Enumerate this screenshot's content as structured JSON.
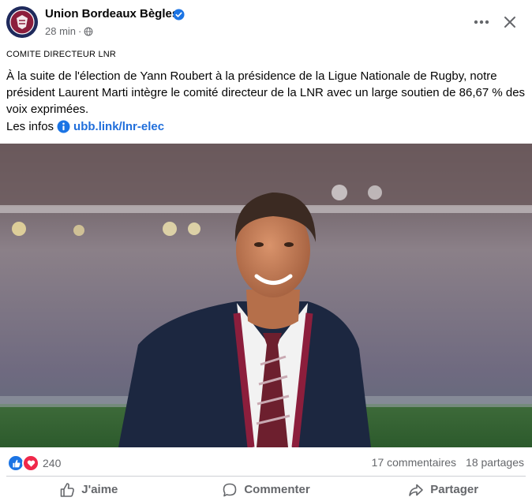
{
  "post": {
    "page_name": "Union Bordeaux Bègles",
    "time": "28 min",
    "separator": "·",
    "kicker": "COMITE DIRECTEUR LNR",
    "text": "À la suite de l'élection de Yann Roubert à la présidence de la Ligue Nationale de Rugby, notre président Laurent Marti intègre le comité directeur de la LNR avec un large soutien de 86,67 % des voix exprimées.",
    "links_label": "Les infos",
    "link_text": "ubb.link/lnr-elec"
  },
  "stats": {
    "reactions_count": "240",
    "comments": "17 commentaires",
    "shares": "18 partages"
  },
  "actions": {
    "like": "J'aime",
    "comment": "Commenter",
    "share": "Partager"
  },
  "icons": {
    "verified": "verified-badge-icon",
    "globe": "globe-icon",
    "more": "more-options-icon",
    "close": "close-icon",
    "info": "info-icon",
    "like": "thumbs-up-icon",
    "love": "heart-icon",
    "comment": "comment-bubble-icon",
    "share": "share-arrow-icon"
  },
  "colors": {
    "link": "#216fdb",
    "verified": "#1b74e4",
    "like_reaction": "#1b74e4",
    "love_reaction": "#f0284a",
    "secondary_text": "#65676b",
    "club_claret": "#8c1e3c"
  }
}
